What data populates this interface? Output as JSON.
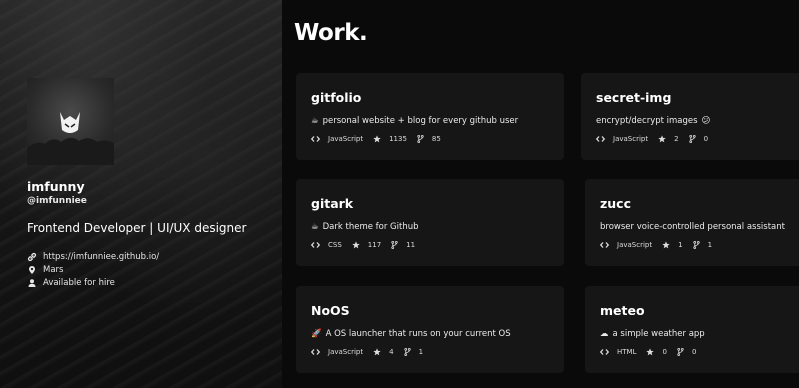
{
  "profile": {
    "name": "imfunny",
    "handle": "@imfunniee",
    "bio": "Frontend Developer | UI/UX designer",
    "website": "https://imfunniee.github.io/",
    "location": "Mars",
    "hire_status": "Available for hire"
  },
  "section_title": "Work.",
  "projects": [
    {
      "title": "gitfolio",
      "emoji": "☕",
      "description": "personal website + blog for every github user",
      "language": "JavaScript",
      "stars": "1135",
      "forks": "85"
    },
    {
      "title": "secret-img",
      "emoji": "",
      "description": "encrypt/decrypt images",
      "emoji_after": "😕",
      "language": "JavaScript",
      "stars": "2",
      "forks": "0"
    },
    {
      "title": "gitark",
      "emoji": "☕",
      "description": "Dark theme for Github",
      "language": "CSS",
      "stars": "117",
      "forks": "11"
    },
    {
      "title": "zucc",
      "emoji": "",
      "description": "browser voice-controlled personal assistant",
      "language": "JavaScript",
      "stars": "1",
      "forks": "1"
    },
    {
      "title": "NoOS",
      "emoji": "🚀",
      "description": "A OS launcher that runs on your current OS",
      "language": "JavaScript",
      "stars": "4",
      "forks": "1"
    },
    {
      "title": "meteo",
      "emoji": "☁",
      "description": "a simple weather app",
      "language": "HTML",
      "stars": "0",
      "forks": "0"
    }
  ],
  "icons": {
    "code": "code-icon",
    "star": "star-icon",
    "fork": "fork-icon",
    "link": "link-icon",
    "location": "location-pin-icon",
    "user": "user-icon"
  }
}
